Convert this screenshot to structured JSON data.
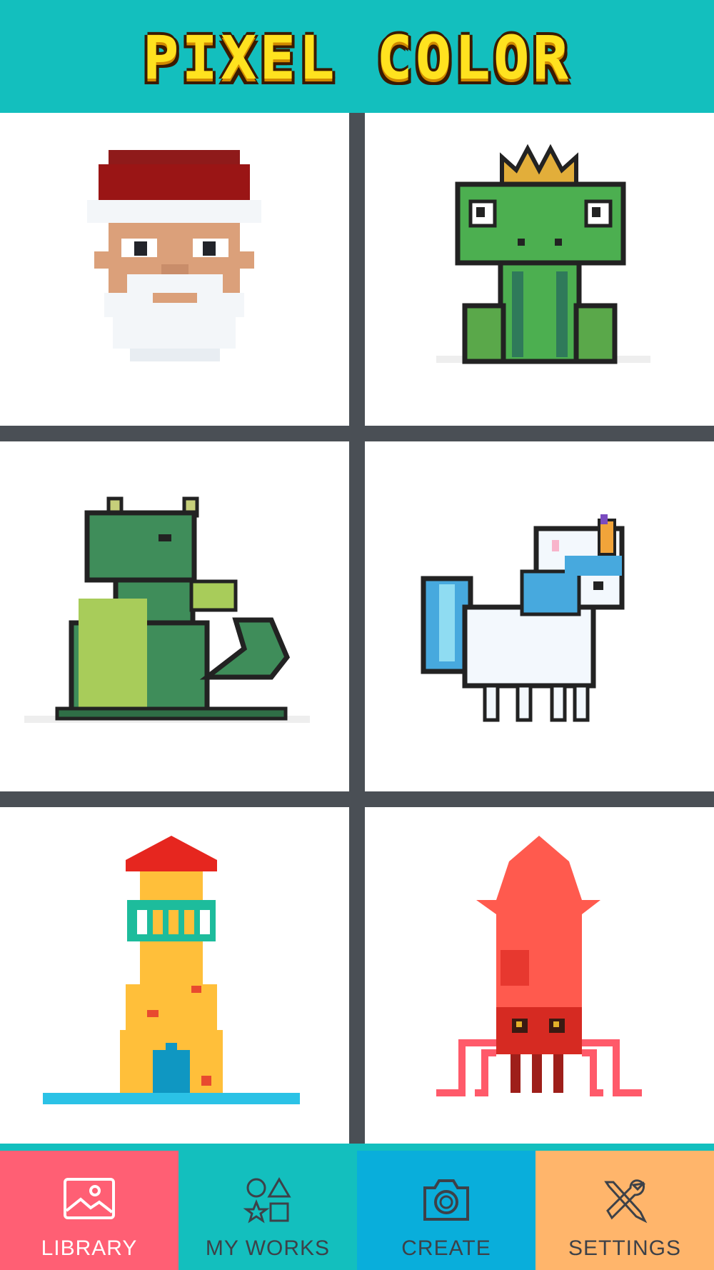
{
  "app": {
    "title": "PIXEL COLOR"
  },
  "gallery": {
    "items": [
      {
        "name": "santa"
      },
      {
        "name": "frog-prince"
      },
      {
        "name": "dragon"
      },
      {
        "name": "unicorn"
      },
      {
        "name": "lighthouse"
      },
      {
        "name": "squid"
      }
    ]
  },
  "tabs": [
    {
      "label": "LIBRARY",
      "icon": "image-icon",
      "color": "#ff5f74",
      "active": true
    },
    {
      "label": "MY WORKS",
      "icon": "shapes-icon",
      "color": "#13bfbe"
    },
    {
      "label": "CREATE",
      "icon": "camera-icon",
      "color": "#09aedb"
    },
    {
      "label": "SETTINGS",
      "icon": "tools-icon",
      "color": "#ffb56b"
    }
  ],
  "colors": {
    "header": "#13bfbe",
    "title": "#ffe21f",
    "grid_divider": "#4a4f55"
  }
}
